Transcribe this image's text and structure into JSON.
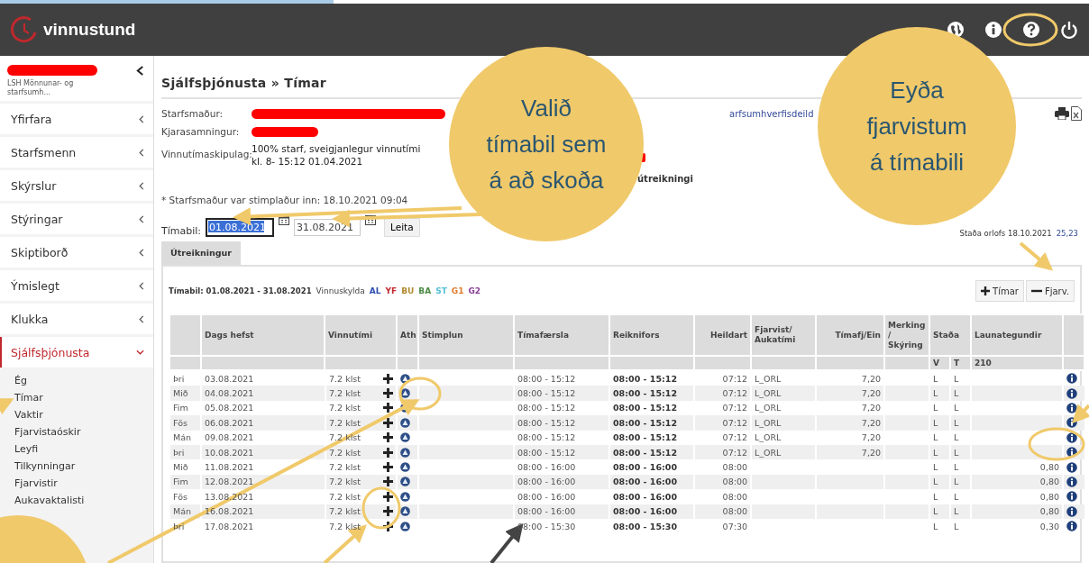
{
  "header": {
    "logo": "vinnustund"
  },
  "sidebar": {
    "org": "LSH Mönnunar- og starfsumh...",
    "items": [
      {
        "label": "Yfirfara",
        "expanded": false
      },
      {
        "label": "Starfsmenn",
        "expanded": false
      },
      {
        "label": "Skýrslur",
        "expanded": false
      },
      {
        "label": "Stýringar",
        "expanded": false
      },
      {
        "label": "Skiptiborð",
        "expanded": false
      },
      {
        "label": "Ýmislegt",
        "expanded": false
      },
      {
        "label": "Klukka",
        "expanded": false
      },
      {
        "label": "Sjálfsþjónusta",
        "expanded": true,
        "children": [
          {
            "label": "Ég"
          },
          {
            "label": "Tímar"
          },
          {
            "label": "Vaktir"
          },
          {
            "label": "Fjarvistaóskir"
          },
          {
            "label": "Leyfi"
          },
          {
            "label": "Tilkynningar"
          },
          {
            "label": "Fjarvistir"
          },
          {
            "label": "Aukavaktalisti"
          }
        ]
      }
    ]
  },
  "breadcrumb": "Sjálfsþjónusta » Tímar",
  "info": {
    "employee_label": "Starfsmaður:",
    "agreement_label": "Kjarasamningur:",
    "schedule_label": "Vinnutímaskipulag:",
    "schedule_value": "100% starf, sveigjanlegur vinnutími kl. 8- 15:12 01.04.2021",
    "unit_link": "arfsumhverfisdeild",
    "calc_note": "útreikningi",
    "clock_note": "* Starfsmaður var stimplaður inn: 18.10.2021 09:04"
  },
  "period": {
    "label": "Tímabil:",
    "from": "01.08.2021",
    "to": "31.08.2021",
    "button": "Leita"
  },
  "vacation": {
    "label": "Staða orlofs 18.10.2021",
    "value": "25,23"
  },
  "tabs": [
    {
      "label": "Útreikningur",
      "selected": true
    }
  ],
  "summary": {
    "period": "Tímabil: 01.08.2021 - 31.08.2021",
    "duty": "Vinnuskylda",
    "codes": [
      {
        "code": "AL",
        "color": "#2f4fb0"
      },
      {
        "code": "YF",
        "color": "#c0282d"
      },
      {
        "code": "BU",
        "color": "#b08a2e"
      },
      {
        "code": "BA",
        "color": "#4b8b45"
      },
      {
        "code": "ST",
        "color": "#55bfd6"
      },
      {
        "code": "G1",
        "color": "#e07b2a"
      },
      {
        "code": "G2",
        "color": "#8a3f9a"
      }
    ]
  },
  "actions": [
    {
      "label": "Tímar",
      "kind": "add"
    },
    {
      "label": "Fjarv.",
      "kind": "remove"
    }
  ],
  "table": {
    "columns": [
      "Dags hefst",
      "Vinnutími",
      "Ath",
      "Stimplun",
      "Tímafærsla",
      "Reiknifors",
      "Heildart",
      "Fjarvist/ Aukatími",
      "Tímafj/Ein",
      "Merking / Skýring",
      "Staða",
      "Launategundir"
    ],
    "subheader": {
      "v": "V",
      "t": "T",
      "pay": "210"
    },
    "rows": [
      {
        "day": "Þri",
        "date": "03.08.2021",
        "hours": "7.2 klst",
        "clock": "08:00 - 15:12",
        "calc": "08:00 - 15:12",
        "total": "07:12",
        "absence": "L_ORL",
        "ratio": "7,20",
        "v": "L",
        "t": "L"
      },
      {
        "day": "Mið",
        "date": "04.08.2021",
        "hours": "7.2 klst",
        "clock": "08:00 - 15:12",
        "calc": "08:00 - 15:12",
        "total": "07:12",
        "absence": "L_ORL",
        "ratio": "7,20",
        "v": "L",
        "t": "L"
      },
      {
        "day": "Fim",
        "date": "05.08.2021",
        "hours": "7.2 klst",
        "clock": "08:00 - 15:12",
        "calc": "08:00 - 15:12",
        "total": "07:12",
        "absence": "L_ORL",
        "ratio": "7,20",
        "v": "L",
        "t": "L"
      },
      {
        "day": "Fös",
        "date": "06.08.2021",
        "hours": "7.2 klst",
        "clock": "08:00 - 15:12",
        "calc": "08:00 - 15:12",
        "total": "07:12",
        "absence": "L_ORL",
        "ratio": "7,20",
        "v": "L",
        "t": "L"
      },
      {
        "day": "Mán",
        "date": "09.08.2021",
        "hours": "7.2 klst",
        "clock": "08:00 - 15:12",
        "calc": "08:00 - 15:12",
        "total": "07:12",
        "absence": "L_ORL",
        "ratio": "7,20",
        "v": "L",
        "t": "L"
      },
      {
        "day": "Þri",
        "date": "10.08.2021",
        "hours": "7.2 klst",
        "clock": "08:00 - 15:12",
        "calc": "08:00 - 15:12",
        "total": "07:12",
        "absence": "L_ORL",
        "ratio": "7,20",
        "v": "L",
        "t": "L"
      },
      {
        "day": "Mið",
        "date": "11.08.2021",
        "hours": "7.2 klst",
        "clock": "08:00 - 16:00",
        "calc": "08:00 - 16:00",
        "total": "08:00",
        "v": "L",
        "t": "L",
        "pay": "0,80"
      },
      {
        "day": "Fim",
        "date": "12.08.2021",
        "hours": "7.2 klst",
        "clock": "08:00 - 16:00",
        "calc": "08:00 - 16:00",
        "total": "08:00",
        "v": "L",
        "t": "L",
        "pay": "0,80"
      },
      {
        "day": "Fös",
        "date": "13.08.2021",
        "hours": "7.2 klst",
        "clock": "08:00 - 16:00",
        "calc": "08:00 - 16:00",
        "total": "08:00",
        "v": "L",
        "t": "L",
        "pay": "0,80"
      },
      {
        "day": "Mán",
        "date": "16.08.2021",
        "hours": "7.2 klst",
        "clock": "08:00 - 16:00",
        "calc": "08:00 - 16:00",
        "total": "08:00",
        "v": "L",
        "t": "L",
        "pay": "0,80"
      },
      {
        "day": "Þri",
        "date": "17.08.2021",
        "hours": "7.2 klst",
        "clock": "08:00 - 15:30",
        "calc": "08:00 - 15:30",
        "total": "07:30",
        "v": "L",
        "t": "L",
        "pay": "0,30"
      }
    ]
  },
  "callouts": [
    {
      "lines": [
        "Valið",
        "tímabil sem",
        "á að skoða"
      ]
    },
    {
      "lines": [
        "Eyða",
        "fjarvistum",
        "á tímabili"
      ]
    }
  ]
}
